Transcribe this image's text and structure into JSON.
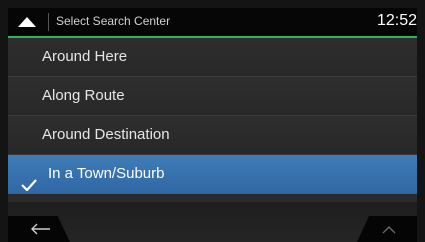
{
  "header": {
    "title": "Select Search Center",
    "clock": "12:52",
    "accent_color": "#2fb35a",
    "up_icon": "up-triangle-icon"
  },
  "options": [
    {
      "label": "Around Here",
      "selected": false
    },
    {
      "label": "Along Route",
      "selected": false
    },
    {
      "label": "Around Destination",
      "selected": false
    },
    {
      "label": "In a Town/Suburb",
      "selected": true
    }
  ],
  "selection_color": "#3a74b0",
  "footer": {
    "back_icon": "back-arrow-icon",
    "scroll_up_icon": "chevron-up-icon"
  }
}
